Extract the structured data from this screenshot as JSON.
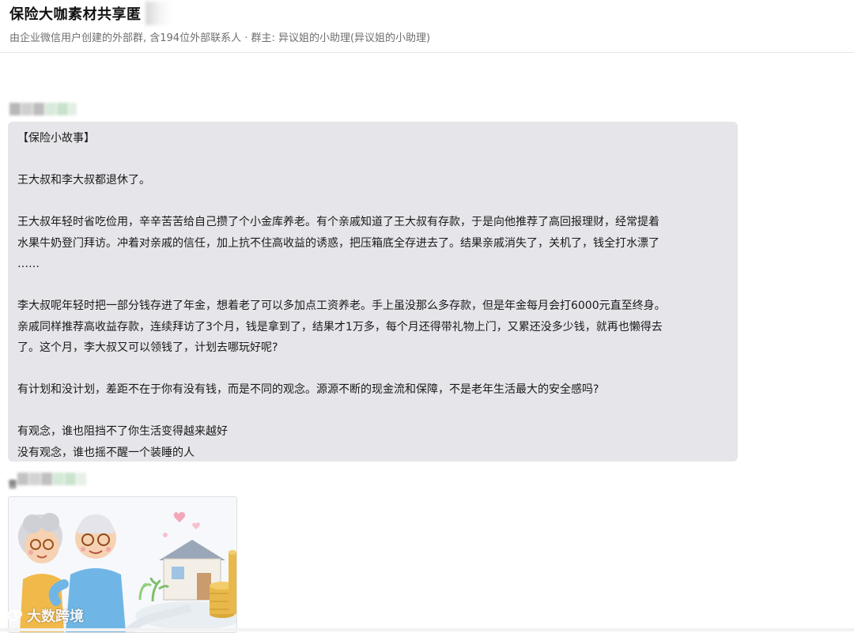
{
  "header": {
    "title": "保险大咖素材共享匿",
    "subtitle": "由企业微信用户创建的外部群, 含194位外部联系人 · 群主: 异议姐的小助理(异议姐的小助理)"
  },
  "messages": [
    {
      "type": "text",
      "lines": [
        "【保险小故事】",
        "",
        "王大叔和李大叔都退休了。",
        "",
        "王大叔年轻时省吃俭用，辛辛苦苦给自己攒了个小金库养老。有个亲戚知道了王大叔有存款，于是向他推荐了高回报理财，经常提着",
        "水果牛奶登门拜访。冲着对亲戚的信任，加上抗不住高收益的诱惑，把压箱底全存进去了。结果亲戚消失了，关机了，钱全打水漂了",
        "……",
        "",
        "李大叔呢年轻时把一部分钱存进了年金，想着老了可以多加点工资养老。手上虽没那么多存款，但是年金每月会打6000元直至终身。",
        "亲戚同样推荐高收益存款，连续拜访了3个月，钱是拿到了，结果才1万多，每个月还得带礼物上门，又累还没多少钱，就再也懒得去",
        "了。这个月，李大叔又可以领钱了，计划去哪玩好呢?",
        "",
        "有计划和没计划，差距不在于你有没有钱，而是不同的观念。源源不断的现金流和保障，不是老年生活最大的安全感吗?",
        "",
        "有观念，谁也阻挡不了你生活变得越来越好",
        "没有观念，谁也摇不醒一个装睡的人"
      ]
    },
    {
      "type": "image",
      "sender_mark": "曹"
    }
  ],
  "watermark": {
    "text": "大数跨境"
  },
  "colors": {
    "bubble": "#e5e5ea",
    "subtitle": "#6e6e6e",
    "border": "#e6e6e6"
  }
}
